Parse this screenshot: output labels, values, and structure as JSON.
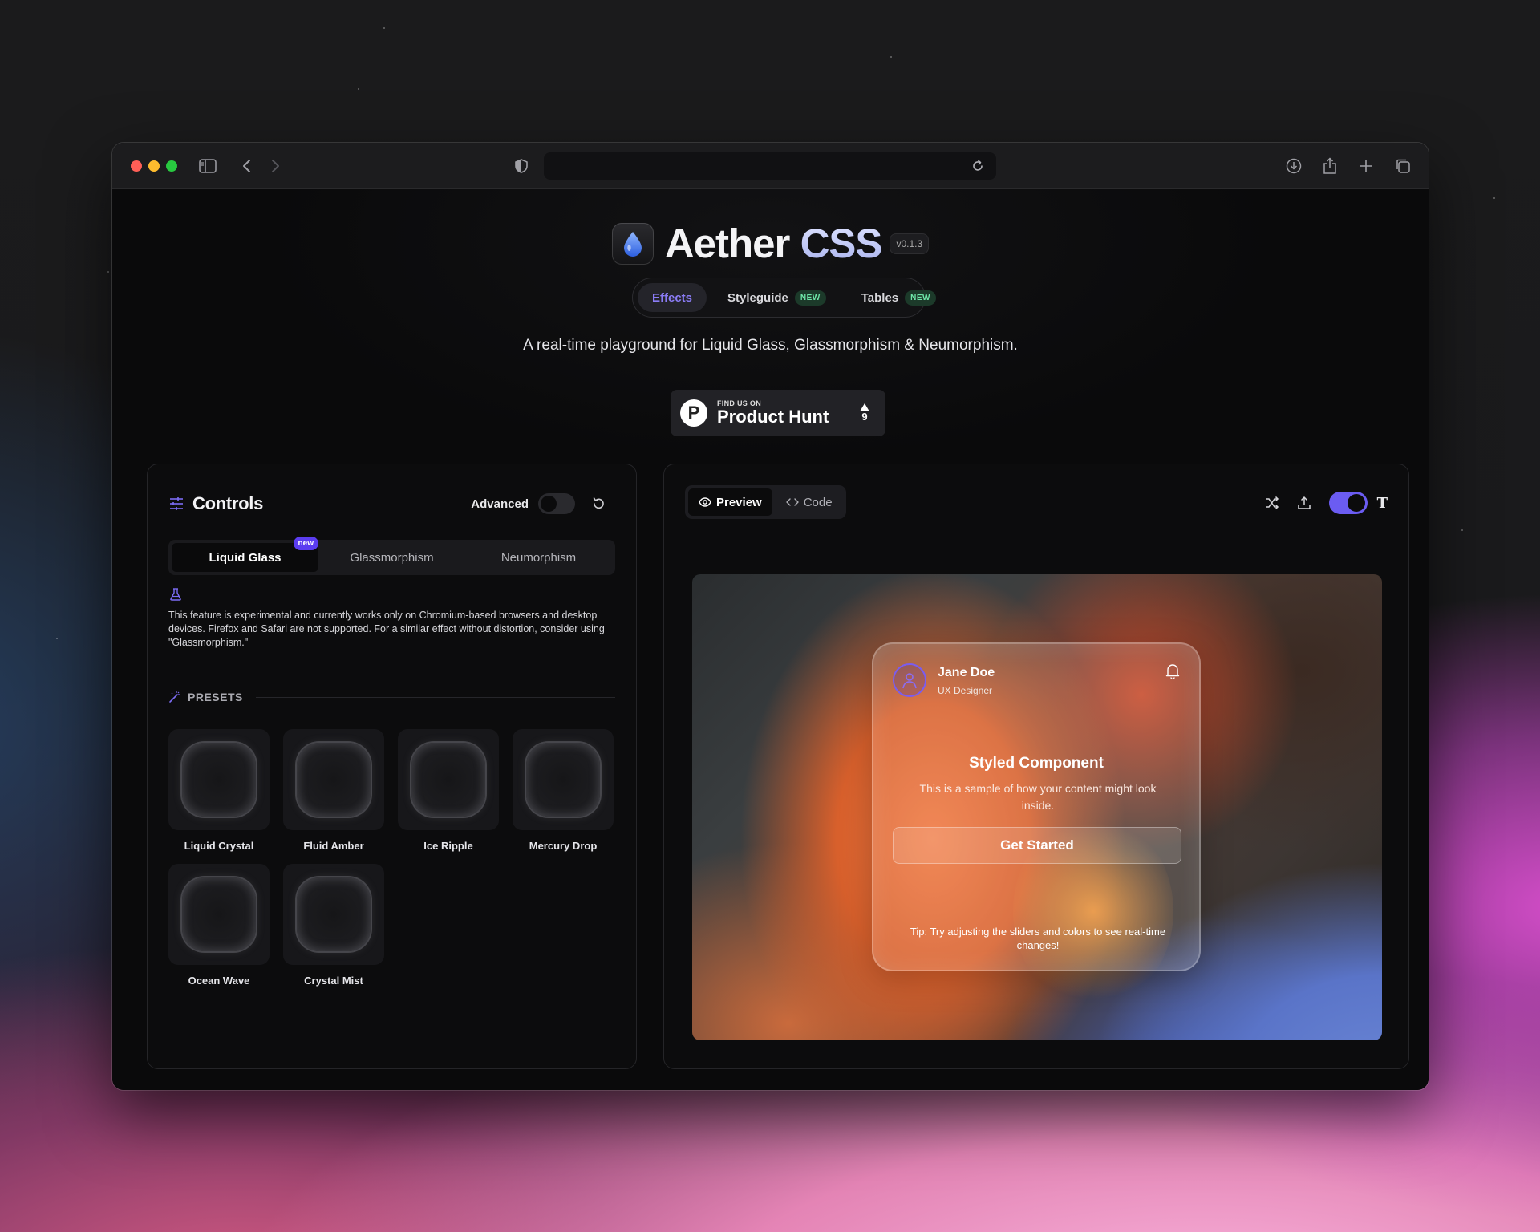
{
  "app": {
    "brand_main": "Aether ",
    "brand_accent": "CSS",
    "version": "v0.1.3",
    "tagline": "A real-time playground for Liquid Glass, Glassmorphism & Neumorphism."
  },
  "nav": {
    "tabs": [
      {
        "label": "Effects",
        "badge": ""
      },
      {
        "label": "Styleguide",
        "badge": "NEW"
      },
      {
        "label": "Tables",
        "badge": "NEW"
      }
    ],
    "active": "Effects"
  },
  "product_hunt": {
    "small": "FIND US ON",
    "big": "Product Hunt",
    "logo_letter": "P",
    "votes": "9"
  },
  "controls": {
    "title": "Controls",
    "advanced_label": "Advanced",
    "advanced_on": false,
    "modes": [
      {
        "label": "Liquid Glass",
        "badge": "new"
      },
      {
        "label": "Glassmorphism",
        "badge": ""
      },
      {
        "label": "Neumorphism",
        "badge": ""
      }
    ],
    "active_mode": "Liquid Glass",
    "notice": "This feature is experimental and currently works only on Chromium-based browsers and desktop devices. Firefox and Safari are not supported. For a similar effect without distortion, consider using \"Glassmorphism.\"",
    "presets_label": "PRESETS",
    "presets": [
      "Liquid Crystal",
      "Fluid Amber",
      "Ice Ripple",
      "Mercury Drop",
      "Ocean Wave",
      "Crystal Mist"
    ]
  },
  "preview": {
    "tabs": [
      "Preview",
      "Code"
    ],
    "active_tab": "Preview",
    "text_toggle_on": true,
    "text_toggle_icon": "T"
  },
  "card": {
    "name": "Jane Doe",
    "role": "UX Designer",
    "heading": "Styled Component",
    "body": "This is a sample of how your content might look inside.",
    "button": "Get Started",
    "tip": "Tip: Try adjusting the sliders and colors to see real-time changes!"
  },
  "colors": {
    "accent": "#8b7cf6",
    "toggle_on": "#6b5cf2",
    "badge_new_text": "#6ee7a8",
    "badge_new_bg": "#1c3a2a"
  }
}
